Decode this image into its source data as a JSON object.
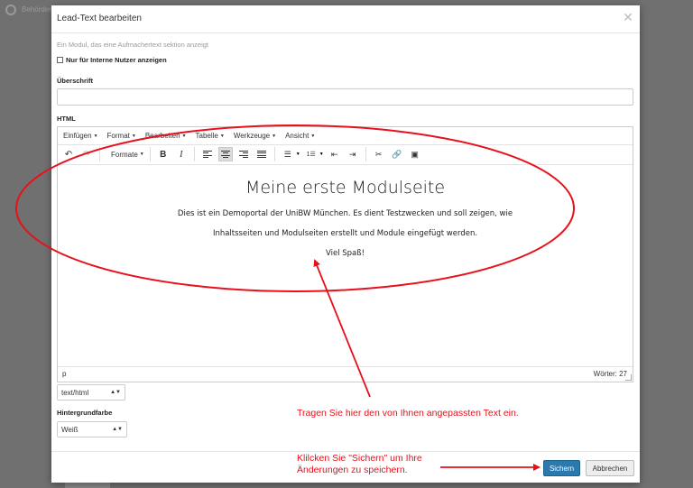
{
  "background": {
    "app_title": "Behörden"
  },
  "modal": {
    "title": "Lead-Text bearbeiten",
    "description": "Ein Modul, das eine Aufmachertext sektion anzeigt",
    "internal_checkbox_label": "Nur für Interne Nutzer anzeigen",
    "internal_checked": false,
    "heading_label": "Überschrift",
    "heading_value": "",
    "html_label": "HTML"
  },
  "editor": {
    "menus": [
      "Einfügen",
      "Format",
      "Bearbeiten",
      "Tabelle",
      "Werkzeuge",
      "Ansicht"
    ],
    "formats_label": "Formate",
    "content": {
      "heading": "Meine erste Modulseite",
      "line1": "Dies ist ein Demoportal der UniBW München. Es dient Testzwecken und soll zeigen, wie",
      "line2": "Inhaltsseiten und Modulseiten erstellt und Module eingefügt werden.",
      "line3": "Viel Spaß!"
    },
    "status_path": "p",
    "word_count": "Wörter: 27"
  },
  "format_select": {
    "value": "text/html"
  },
  "background_color": {
    "label": "Hintergrundfarbe",
    "value": "Weiß"
  },
  "buttons": {
    "save": "Sichern",
    "cancel": "Abbrechen"
  },
  "annotations": {
    "editor_hint": "Tragen Sie hier den von Ihnen angepassten Text ein.",
    "save_hint_line1": "Klilcken Sie \"Sichern\" um Ihre",
    "save_hint_line2": "Änderungen zu speichern.",
    "color": "#e8101a"
  },
  "colors": {
    "primary": "#2a7ab0",
    "overlay": "#707070"
  }
}
